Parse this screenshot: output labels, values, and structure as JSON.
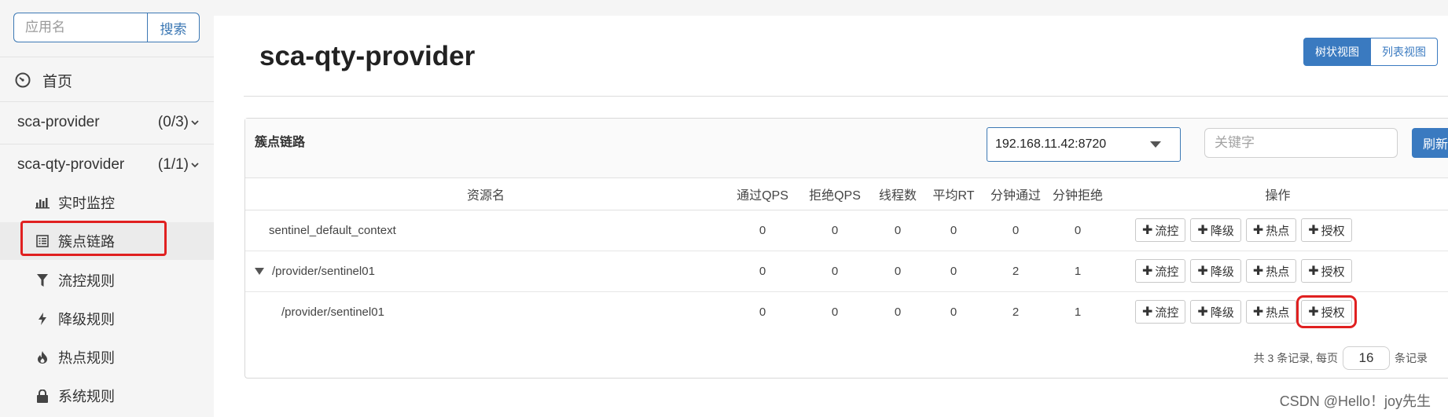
{
  "sidebar": {
    "search_placeholder": "应用名",
    "search_button": "搜索",
    "home": "首页",
    "apps": [
      {
        "name": "sca-provider",
        "count": "(0/3)"
      },
      {
        "name": "sca-qty-provider",
        "count": "(1/1)"
      }
    ],
    "items": [
      {
        "label": "实时监控",
        "icon": "bar-chart-icon"
      },
      {
        "label": "簇点链路",
        "icon": "list-icon"
      },
      {
        "label": "流控规则",
        "icon": "filter-icon"
      },
      {
        "label": "降级规则",
        "icon": "bolt-icon"
      },
      {
        "label": "热点规则",
        "icon": "fire-icon"
      },
      {
        "label": "系统规则",
        "icon": "lock-icon"
      }
    ]
  },
  "main": {
    "title": "sca-qty-provider",
    "view_tree": "树状视图",
    "view_list": "列表视图",
    "panel_title": "簇点链路",
    "machine": "192.168.11.42:8720",
    "keyword_placeholder": "关键字",
    "refresh": "刷新",
    "columns": [
      "资源名",
      "通过QPS",
      "拒绝QPS",
      "线程数",
      "平均RT",
      "分钟通过",
      "分钟拒绝",
      "操作"
    ],
    "rows": [
      {
        "name": "sentinel_default_context",
        "pass_qps": "0",
        "block_qps": "0",
        "threads": "0",
        "avg_rt": "0",
        "min_pass": "0",
        "min_block": "0"
      },
      {
        "name": "/provider/sentinel01",
        "pass_qps": "0",
        "block_qps": "0",
        "threads": "0",
        "avg_rt": "0",
        "min_pass": "2",
        "min_block": "1"
      },
      {
        "name": "/provider/sentinel01",
        "pass_qps": "0",
        "block_qps": "0",
        "threads": "0",
        "avg_rt": "0",
        "min_pass": "2",
        "min_block": "1"
      }
    ],
    "ops": {
      "flow": "流控",
      "degrade": "降级",
      "hot": "热点",
      "auth": "授权"
    },
    "pager": {
      "prefix": "共 3 条记录, 每页",
      "size": "16",
      "suffix": "条记录"
    }
  },
  "watermark": "CSDN @Hello！joy先生",
  "colors": {
    "accent": "#3a7ac0",
    "highlight": "#e02020"
  }
}
